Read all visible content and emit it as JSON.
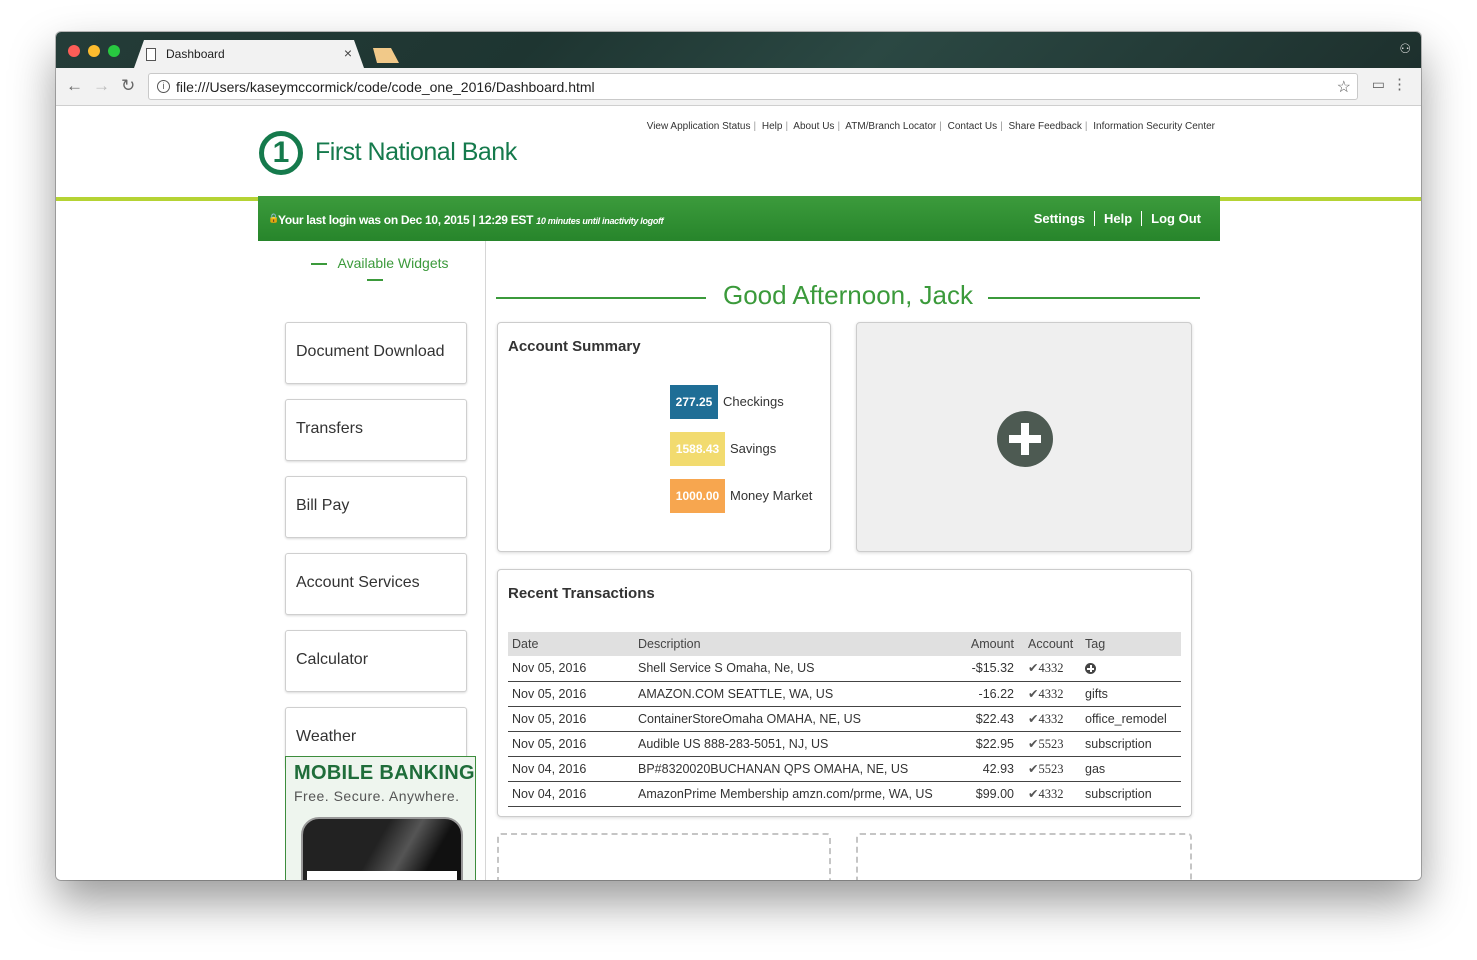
{
  "browser": {
    "tab_title": "Dashboard",
    "url": "file:///Users/kaseymccormick/code/code_one_2016/Dashboard.html"
  },
  "bank": {
    "name": "First National Bank",
    "logo_mark": "1"
  },
  "top_links": [
    "View Application Status",
    "Help",
    "About Us",
    "ATM/Branch Locator",
    "Contact Us",
    "Share Feedback",
    "Information Security Center"
  ],
  "statusbar": {
    "last_login": "Your last login was on Dec 10, 2015 | 12:29 EST",
    "inactivity": "10 minutes until inactivity logoff",
    "links": [
      "Settings",
      "Help",
      "Log Out"
    ]
  },
  "sidebar": {
    "title": "Available Widgets",
    "widgets": [
      "Document Download",
      "Transfers",
      "Bill Pay",
      "Account Services",
      "Calculator",
      "Weather"
    ],
    "ad_title": "MOBILE BANKING",
    "ad_subtitle": "Free. Secure. Anywhere."
  },
  "greeting": "Good Afternoon, Jack",
  "account_summary": {
    "title": "Account Summary",
    "accounts": [
      {
        "value": "277.25",
        "name": "Checkings",
        "color": "#1f6e96"
      },
      {
        "value": "1588.43",
        "name": "Savings",
        "color": "#f2db6f"
      },
      {
        "value": "1000.00",
        "name": "Money Market",
        "color": "#f7a64f"
      }
    ]
  },
  "transactions": {
    "title": "Recent Transactions",
    "columns": [
      "Date",
      "Description",
      "Amount",
      "Account",
      "Tag"
    ],
    "rows": [
      {
        "date": "Nov 05, 2016",
        "description": "Shell Service S Omaha, Ne, US",
        "amount": "-$15.32",
        "negative": true,
        "account": "4332",
        "tag": ""
      },
      {
        "date": "Nov 05, 2016",
        "description": "AMAZON.COM SEATTLE, WA, US",
        "amount": "-16.22",
        "negative": true,
        "account": "4332",
        "tag": "gifts"
      },
      {
        "date": "Nov 05, 2016",
        "description": "ContainerStoreOmaha OMAHA, NE, US",
        "amount": "$22.43",
        "negative": false,
        "account": "4332",
        "tag": "office_remodel"
      },
      {
        "date": "Nov 05, 2016",
        "description": "Audible US 888-283-5051, NJ, US",
        "amount": "$22.95",
        "negative": false,
        "account": "5523",
        "tag": "subscription"
      },
      {
        "date": "Nov 04, 2016",
        "description": "BP#8320020BUCHANAN QPS OMAHA, NE, US",
        "amount": "42.93",
        "negative": false,
        "account": "5523",
        "tag": "gas"
      },
      {
        "date": "Nov 04, 2016",
        "description": "AmazonPrime Membership amzn.com/prme, WA, US",
        "amount": "$99.00",
        "negative": true,
        "account": "4332",
        "tag": "subscription"
      }
    ]
  }
}
